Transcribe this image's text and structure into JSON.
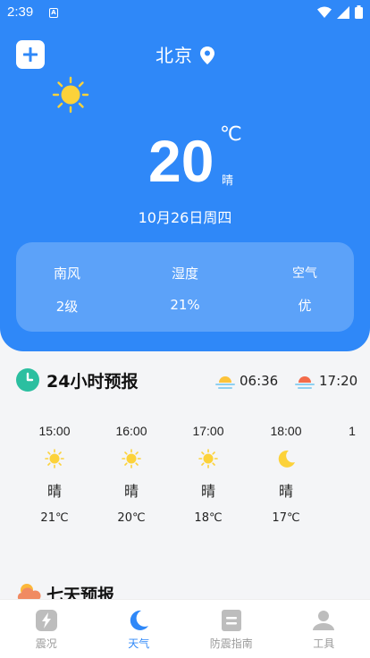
{
  "status_bar": {
    "time": "2:39",
    "notif_letter": "A"
  },
  "header": {
    "city": "北京",
    "temperature": "20",
    "unit": "℃",
    "condition": "晴",
    "date": "10月26日周四"
  },
  "stats": [
    {
      "label": "南风",
      "value": "2级"
    },
    {
      "label": "湿度",
      "value": "21%"
    },
    {
      "label": "空气",
      "value": "优"
    }
  ],
  "forecast_24h": {
    "title": "24小时预报",
    "sunrise": "06:36",
    "sunset": "17:20",
    "hours": [
      {
        "time": "15:00",
        "icon": "sun-icon",
        "condition": "晴",
        "temp": "21℃"
      },
      {
        "time": "16:00",
        "icon": "sun-icon",
        "condition": "晴",
        "temp": "20℃"
      },
      {
        "time": "17:00",
        "icon": "sun-icon",
        "condition": "晴",
        "temp": "18℃"
      },
      {
        "time": "18:00",
        "icon": "moon-icon",
        "condition": "晴",
        "temp": "17℃"
      },
      {
        "time": "1",
        "icon": "",
        "condition": "",
        "temp": ""
      }
    ]
  },
  "forecast_7d": {
    "title": "七天预报"
  },
  "nav": [
    {
      "label": "震况",
      "icon": "lightning-icon",
      "active": false
    },
    {
      "label": "天气",
      "icon": "moon-icon",
      "active": true
    },
    {
      "label": "防震指南",
      "icon": "document-icon",
      "active": false
    },
    {
      "label": "工具",
      "icon": "user-icon",
      "active": false
    }
  ],
  "colors": {
    "accent": "#2f88f8",
    "sun": "#fcd23a",
    "inactive": "#bdbdbd"
  }
}
